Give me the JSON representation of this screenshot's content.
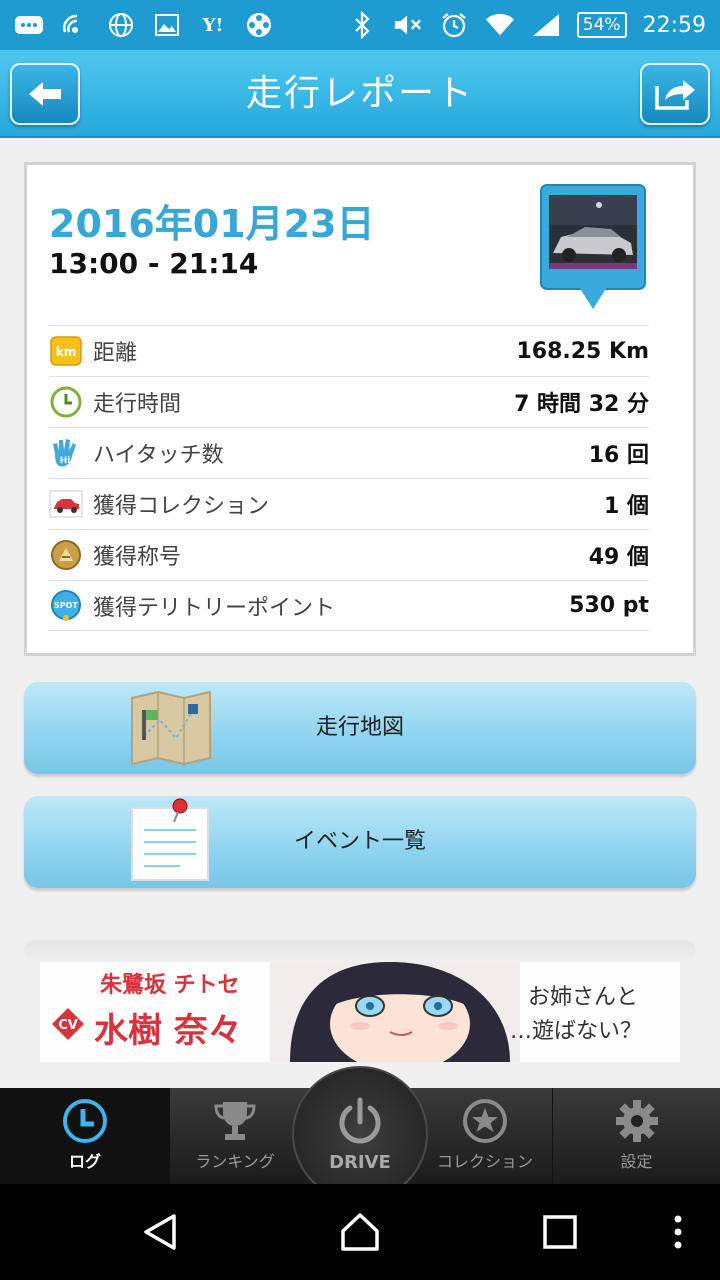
{
  "status_bar": {
    "battery": "54%",
    "time": "22:59",
    "yahoo_glyph": "Y!"
  },
  "header": {
    "title": "走行レポート"
  },
  "report": {
    "date": "2016年01月23日",
    "time_range": "13:00 - 21:14",
    "km_badge": "km",
    "hi_badge": "Hi",
    "spot_badge": "SPOT",
    "rows": [
      {
        "icon": "km-icon",
        "label": "距離",
        "value": "168.25 Km"
      },
      {
        "icon": "clock-icon",
        "label": "走行時間",
        "value": "7 時間 32 分"
      },
      {
        "icon": "hi-five-icon",
        "label": "ハイタッチ数",
        "value": "16 回"
      },
      {
        "icon": "car-icon",
        "label": "獲得コレクション",
        "value": "1 個"
      },
      {
        "icon": "medal-icon",
        "label": "獲得称号",
        "value": "49 個"
      },
      {
        "icon": "spot-icon",
        "label": "獲得テリトリーポイント",
        "value": "530 pt"
      }
    ]
  },
  "menu": {
    "map_label": "走行地図",
    "events_label": "イベント一覧"
  },
  "banner": {
    "role": "朱鷺坂 チトセ",
    "cv": "CV",
    "name": "水樹 奈々",
    "line1": "お姉さんと",
    "line2": "…遊ばない？"
  },
  "tabs": {
    "log": "ログ",
    "ranking": "ランキング",
    "drive": "DRIVE",
    "collection": "コレクション",
    "settings": "設定"
  },
  "colors": {
    "accent": "#36a7d6",
    "header": "#25a8dc",
    "tabbar": "#1b1b1b"
  }
}
